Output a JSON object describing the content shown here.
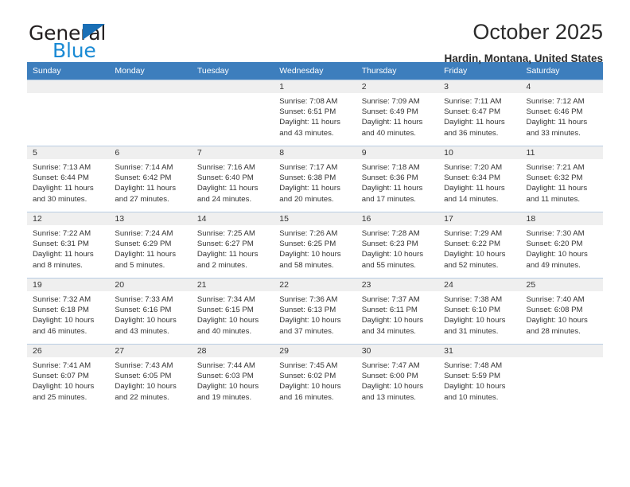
{
  "brand": {
    "name_top": "General",
    "name_bottom": "Blue",
    "accent_color": "#1a8ad4",
    "triangle_color": "#1a6fb5"
  },
  "header": {
    "title": "October 2025",
    "subtitle": "Hardin, Montana, United States"
  },
  "calendar": {
    "header_bg": "#3d7ebd",
    "daynum_bg": "#efefef",
    "weekday_headers": [
      "Sunday",
      "Monday",
      "Tuesday",
      "Wednesday",
      "Thursday",
      "Friday",
      "Saturday"
    ],
    "weeks": [
      [
        {
          "day": "",
          "sunrise": "",
          "sunset": "",
          "daylight1": "",
          "daylight2": ""
        },
        {
          "day": "",
          "sunrise": "",
          "sunset": "",
          "daylight1": "",
          "daylight2": ""
        },
        {
          "day": "",
          "sunrise": "",
          "sunset": "",
          "daylight1": "",
          "daylight2": ""
        },
        {
          "day": "1",
          "sunrise": "Sunrise: 7:08 AM",
          "sunset": "Sunset: 6:51 PM",
          "daylight1": "Daylight: 11 hours",
          "daylight2": "and 43 minutes."
        },
        {
          "day": "2",
          "sunrise": "Sunrise: 7:09 AM",
          "sunset": "Sunset: 6:49 PM",
          "daylight1": "Daylight: 11 hours",
          "daylight2": "and 40 minutes."
        },
        {
          "day": "3",
          "sunrise": "Sunrise: 7:11 AM",
          "sunset": "Sunset: 6:47 PM",
          "daylight1": "Daylight: 11 hours",
          "daylight2": "and 36 minutes."
        },
        {
          "day": "4",
          "sunrise": "Sunrise: 7:12 AM",
          "sunset": "Sunset: 6:46 PM",
          "daylight1": "Daylight: 11 hours",
          "daylight2": "and 33 minutes."
        }
      ],
      [
        {
          "day": "5",
          "sunrise": "Sunrise: 7:13 AM",
          "sunset": "Sunset: 6:44 PM",
          "daylight1": "Daylight: 11 hours",
          "daylight2": "and 30 minutes."
        },
        {
          "day": "6",
          "sunrise": "Sunrise: 7:14 AM",
          "sunset": "Sunset: 6:42 PM",
          "daylight1": "Daylight: 11 hours",
          "daylight2": "and 27 minutes."
        },
        {
          "day": "7",
          "sunrise": "Sunrise: 7:16 AM",
          "sunset": "Sunset: 6:40 PM",
          "daylight1": "Daylight: 11 hours",
          "daylight2": "and 24 minutes."
        },
        {
          "day": "8",
          "sunrise": "Sunrise: 7:17 AM",
          "sunset": "Sunset: 6:38 PM",
          "daylight1": "Daylight: 11 hours",
          "daylight2": "and 20 minutes."
        },
        {
          "day": "9",
          "sunrise": "Sunrise: 7:18 AM",
          "sunset": "Sunset: 6:36 PM",
          "daylight1": "Daylight: 11 hours",
          "daylight2": "and 17 minutes."
        },
        {
          "day": "10",
          "sunrise": "Sunrise: 7:20 AM",
          "sunset": "Sunset: 6:34 PM",
          "daylight1": "Daylight: 11 hours",
          "daylight2": "and 14 minutes."
        },
        {
          "day": "11",
          "sunrise": "Sunrise: 7:21 AM",
          "sunset": "Sunset: 6:32 PM",
          "daylight1": "Daylight: 11 hours",
          "daylight2": "and 11 minutes."
        }
      ],
      [
        {
          "day": "12",
          "sunrise": "Sunrise: 7:22 AM",
          "sunset": "Sunset: 6:31 PM",
          "daylight1": "Daylight: 11 hours",
          "daylight2": "and 8 minutes."
        },
        {
          "day": "13",
          "sunrise": "Sunrise: 7:24 AM",
          "sunset": "Sunset: 6:29 PM",
          "daylight1": "Daylight: 11 hours",
          "daylight2": "and 5 minutes."
        },
        {
          "day": "14",
          "sunrise": "Sunrise: 7:25 AM",
          "sunset": "Sunset: 6:27 PM",
          "daylight1": "Daylight: 11 hours",
          "daylight2": "and 2 minutes."
        },
        {
          "day": "15",
          "sunrise": "Sunrise: 7:26 AM",
          "sunset": "Sunset: 6:25 PM",
          "daylight1": "Daylight: 10 hours",
          "daylight2": "and 58 minutes."
        },
        {
          "day": "16",
          "sunrise": "Sunrise: 7:28 AM",
          "sunset": "Sunset: 6:23 PM",
          "daylight1": "Daylight: 10 hours",
          "daylight2": "and 55 minutes."
        },
        {
          "day": "17",
          "sunrise": "Sunrise: 7:29 AM",
          "sunset": "Sunset: 6:22 PM",
          "daylight1": "Daylight: 10 hours",
          "daylight2": "and 52 minutes."
        },
        {
          "day": "18",
          "sunrise": "Sunrise: 7:30 AM",
          "sunset": "Sunset: 6:20 PM",
          "daylight1": "Daylight: 10 hours",
          "daylight2": "and 49 minutes."
        }
      ],
      [
        {
          "day": "19",
          "sunrise": "Sunrise: 7:32 AM",
          "sunset": "Sunset: 6:18 PM",
          "daylight1": "Daylight: 10 hours",
          "daylight2": "and 46 minutes."
        },
        {
          "day": "20",
          "sunrise": "Sunrise: 7:33 AM",
          "sunset": "Sunset: 6:16 PM",
          "daylight1": "Daylight: 10 hours",
          "daylight2": "and 43 minutes."
        },
        {
          "day": "21",
          "sunrise": "Sunrise: 7:34 AM",
          "sunset": "Sunset: 6:15 PM",
          "daylight1": "Daylight: 10 hours",
          "daylight2": "and 40 minutes."
        },
        {
          "day": "22",
          "sunrise": "Sunrise: 7:36 AM",
          "sunset": "Sunset: 6:13 PM",
          "daylight1": "Daylight: 10 hours",
          "daylight2": "and 37 minutes."
        },
        {
          "day": "23",
          "sunrise": "Sunrise: 7:37 AM",
          "sunset": "Sunset: 6:11 PM",
          "daylight1": "Daylight: 10 hours",
          "daylight2": "and 34 minutes."
        },
        {
          "day": "24",
          "sunrise": "Sunrise: 7:38 AM",
          "sunset": "Sunset: 6:10 PM",
          "daylight1": "Daylight: 10 hours",
          "daylight2": "and 31 minutes."
        },
        {
          "day": "25",
          "sunrise": "Sunrise: 7:40 AM",
          "sunset": "Sunset: 6:08 PM",
          "daylight1": "Daylight: 10 hours",
          "daylight2": "and 28 minutes."
        }
      ],
      [
        {
          "day": "26",
          "sunrise": "Sunrise: 7:41 AM",
          "sunset": "Sunset: 6:07 PM",
          "daylight1": "Daylight: 10 hours",
          "daylight2": "and 25 minutes."
        },
        {
          "day": "27",
          "sunrise": "Sunrise: 7:43 AM",
          "sunset": "Sunset: 6:05 PM",
          "daylight1": "Daylight: 10 hours",
          "daylight2": "and 22 minutes."
        },
        {
          "day": "28",
          "sunrise": "Sunrise: 7:44 AM",
          "sunset": "Sunset: 6:03 PM",
          "daylight1": "Daylight: 10 hours",
          "daylight2": "and 19 minutes."
        },
        {
          "day": "29",
          "sunrise": "Sunrise: 7:45 AM",
          "sunset": "Sunset: 6:02 PM",
          "daylight1": "Daylight: 10 hours",
          "daylight2": "and 16 minutes."
        },
        {
          "day": "30",
          "sunrise": "Sunrise: 7:47 AM",
          "sunset": "Sunset: 6:00 PM",
          "daylight1": "Daylight: 10 hours",
          "daylight2": "and 13 minutes."
        },
        {
          "day": "31",
          "sunrise": "Sunrise: 7:48 AM",
          "sunset": "Sunset: 5:59 PM",
          "daylight1": "Daylight: 10 hours",
          "daylight2": "and 10 minutes."
        },
        {
          "day": "",
          "sunrise": "",
          "sunset": "",
          "daylight1": "",
          "daylight2": ""
        }
      ]
    ]
  }
}
